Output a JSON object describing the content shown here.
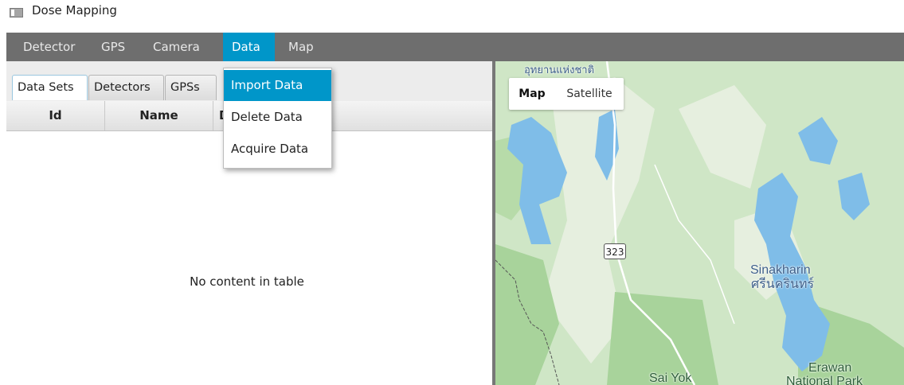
{
  "window": {
    "title": "Dose Mapping"
  },
  "menubar": {
    "items": [
      "Detector",
      "GPS",
      "Camera",
      "Data",
      "Map"
    ],
    "active": "Data"
  },
  "tabs": {
    "items": [
      "Data Sets",
      "Detectors",
      "GPSs"
    ],
    "selected": "Data Sets"
  },
  "table": {
    "columns": [
      "Id",
      "Name",
      "D"
    ],
    "empty_message": "No content in table"
  },
  "data_menu": {
    "items": [
      "Import Data",
      "Delete Data",
      "Acquire Data"
    ],
    "highlighted": "Import Data"
  },
  "map": {
    "type_buttons": [
      "Map",
      "Satellite"
    ],
    "selected_type": "Map",
    "labels": {
      "top_thai": "อุทยานแห่งชาติ",
      "sinakharin": "Sinakharin",
      "sinakharin_thai": "ศรีนครินทร์",
      "sai_yok": "Sai Yok",
      "erawan_1": "Erawan",
      "erawan_2": "National Park"
    },
    "road_shield": "323"
  },
  "colors": {
    "menubar": "#6e6e6e",
    "accent": "#0096c9",
    "water": "#7fbde8",
    "forest": "#a8d39b",
    "land": "#dbe9d3"
  }
}
